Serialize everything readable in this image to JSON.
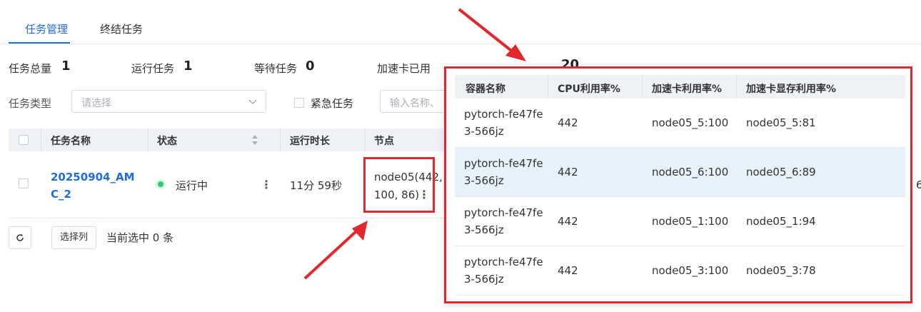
{
  "tabs": {
    "task_management": "任务管理",
    "finished_tasks": "终结任务"
  },
  "stats": {
    "total_label": "任务总量",
    "total_value": "1",
    "running_label": "运行任务",
    "running_value": "1",
    "waiting_label": "等待任务",
    "waiting_value": "0",
    "accel_label": "加速卡已用",
    "hidden_tail": "20"
  },
  "filters": {
    "type_label": "任务类型",
    "type_placeholder": "请选择",
    "urgent_label": "紧急任务",
    "search_placeholder": "输入名称、"
  },
  "table": {
    "headers": {
      "name": "任务名称",
      "status": "状态",
      "runtime": "运行时长",
      "node": "节点"
    },
    "row": {
      "name": "20250904_AMC_2",
      "status": "运行中",
      "runtime": "11分 59秒",
      "node": "node05(442, 100, 86)",
      "overflow_digit": "6"
    }
  },
  "footer": {
    "select_columns": "选择列",
    "selected_info": "当前选中 0 条"
  },
  "popover": {
    "headers": {
      "container": "容器名称",
      "cpu": "CPU利用率%",
      "accel": "加速卡利用率%",
      "mem": "加速卡显存利用率%"
    },
    "rows": [
      {
        "container": "pytorch-fe47fe3-566jz",
        "cpu": "442",
        "accel": "node05_5:100",
        "mem": "node05_5:81"
      },
      {
        "container": "pytorch-fe47fe3-566jz",
        "cpu": "442",
        "accel": "node05_6:100",
        "mem": "node05_6:89"
      },
      {
        "container": "pytorch-fe47fe3-566jz",
        "cpu": "442",
        "accel": "node05_1:100",
        "mem": "node05_1:94"
      },
      {
        "container": "pytorch-fe47fe3-566jz",
        "cpu": "442",
        "accel": "node05_3:100",
        "mem": "node05_3:78"
      }
    ]
  },
  "colors": {
    "accent": "#1f6fd8",
    "annotation_red": "#e0282e",
    "running_green": "#2ecc71",
    "highlight_row": "#e7f2fb"
  }
}
